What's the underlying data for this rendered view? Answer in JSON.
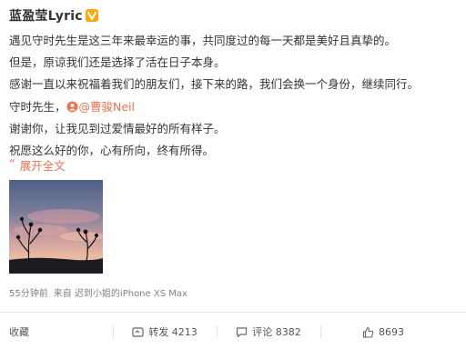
{
  "post": {
    "author": "蓝盈莹Lyric",
    "lines": [
      "遇见守时先生是这三年来最幸运的事，共同度过的每一天都是美好且真挚的。",
      "但是，原谅我们还是选择了活在日子本身。",
      "感谢一直以来祝福着我们的朋友们，接下来的路，我们会换一个身份，继续同行。"
    ],
    "mention_prefix": "守时先生，",
    "mention_name": "@曹骏Neil",
    "lines_after": [
      "谢谢你，让我见到过爱情最好的所有样子。",
      "祝愿这么好的你，心有所向，终有所得。"
    ],
    "expand_label": "展开全文",
    "time": "55分钟前",
    "source_prefix": "来自",
    "source": "迟到小姐的iPhone XS Max"
  },
  "actions": {
    "favorite": "收藏",
    "repost": "转发 4213",
    "comment": "评论 8382",
    "like": "8693"
  },
  "colors": {
    "accent": "#eb7350",
    "meta": "#808080",
    "text": "#333333",
    "badge": "#f7a70f"
  }
}
